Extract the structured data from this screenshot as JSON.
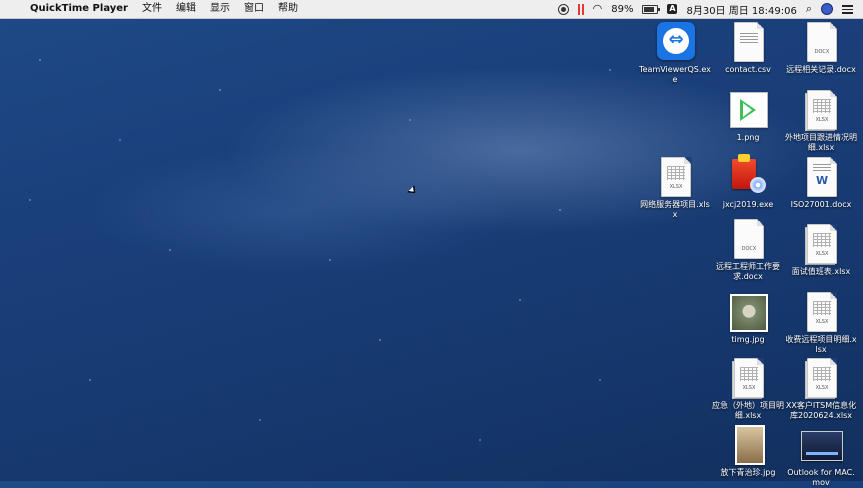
{
  "menubar": {
    "app_name": "QuickTime Player",
    "menus": [
      "文件",
      "编辑",
      "显示",
      "窗口",
      "帮助"
    ],
    "battery": "89%",
    "datetime": "8月30日 周日 18:49:06"
  },
  "desktop": {
    "icons": [
      {
        "label": "TeamViewerQS.exe",
        "type": "teamviewer-app"
      },
      {
        "label": "contact.csv",
        "type": "csv"
      },
      {
        "label": "远程相关记录.docx",
        "type": "docx",
        "tag": "DOCX"
      },
      {
        "label": "1.png",
        "type": "png"
      },
      {
        "label": "外地项目跟进情况明细.xlsx",
        "type": "xlsx",
        "tag": "XLSX"
      },
      {
        "label": "网络服务器项目.xlsx",
        "type": "xlsx",
        "tag": "XLSX"
      },
      {
        "label": "jxcj2019.exe",
        "type": "exe"
      },
      {
        "label": "ISO27001.docx",
        "type": "word"
      },
      {
        "label": "远程工程师工作要求.docx",
        "type": "docx",
        "tag": "DOCX"
      },
      {
        "label": "面试值班表.xlsx",
        "type": "xlsx",
        "tag": "XLSX"
      },
      {
        "label": "timg.jpg",
        "type": "jpg"
      },
      {
        "label": "收费远程项目明细.xlsx",
        "type": "xlsx",
        "tag": "XLSX"
      },
      {
        "label": "应急（外地）项目明细.xlsx",
        "type": "xlsx",
        "tag": "XLSX"
      },
      {
        "label": "XX客户ITSM信息化库2020624.xlsx",
        "type": "xlsx",
        "tag": "XLSX"
      },
      {
        "label": "放下青治珍.jpg",
        "type": "jpg"
      },
      {
        "label": "Outlook for MAC.mov",
        "type": "mov"
      }
    ]
  }
}
